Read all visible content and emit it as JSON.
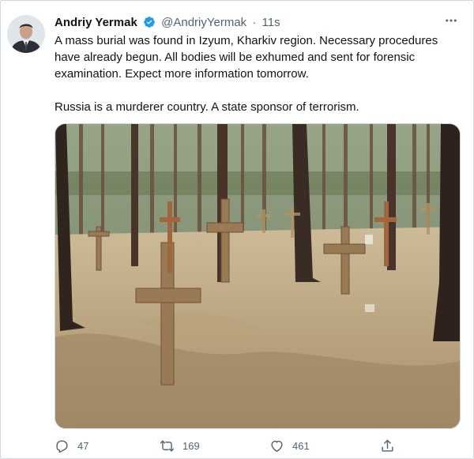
{
  "tweet": {
    "author_name": "Andriy Yermak",
    "handle": "@AndriyYermak",
    "separator": "·",
    "time": "11s",
    "verified": true,
    "text_line_1": "A mass burial was found in Izyum, Kharkiv region. Necessary procedures have already begun. All bodies will be exhumed and sent for forensic examination. Expect more information tomorrow.",
    "text_line_2": "Russia is a murderer country. A state sponsor of terrorism.",
    "more_icon": "more-horizontal-icon",
    "media_icon": "photo-of-forest-graves"
  },
  "actions": {
    "replies": "47",
    "retweets": "169",
    "likes": "461"
  },
  "colors": {
    "accent": "#1d9bf0",
    "muted": "#536471",
    "border": "#cfd9de"
  }
}
